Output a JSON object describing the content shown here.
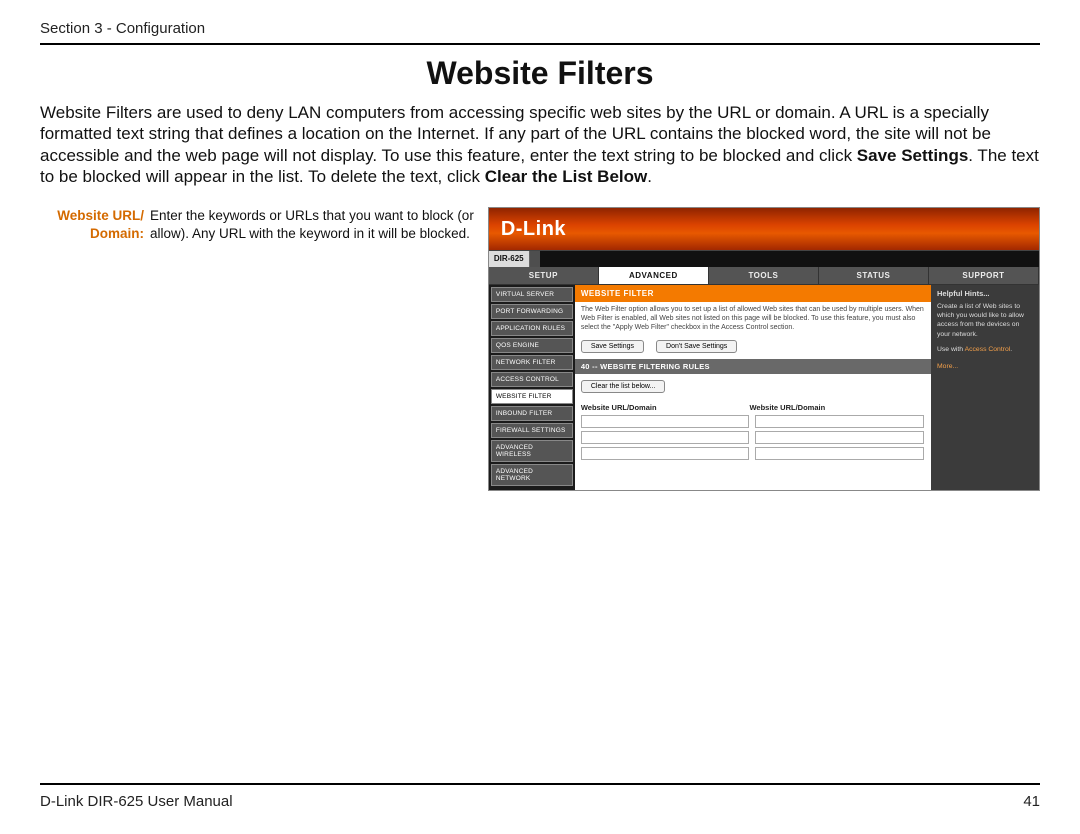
{
  "header": {
    "section": "Section 3 - Configuration"
  },
  "title": "Website Filters",
  "intro_p1": "Website Filters are used to deny LAN computers from accessing specific web sites by the URL or domain. A URL is a specially formatted text string that defines a location on the Internet. If any part of the URL contains the blocked word, the site will not be accessible and the web page will not display. To use this feature, enter the text string to be blocked and click ",
  "intro_b1": "Save Settings",
  "intro_p2": ". The text to be blocked will appear in the list. To delete the text, click ",
  "intro_b2": "Clear the List Below",
  "intro_p3": ".",
  "desc": {
    "label": "Website URL/ Domain:",
    "text": "Enter the keywords or URLs that you want to block (or allow). Any URL with the keyword in it will be blocked."
  },
  "router": {
    "brand": "D-Link",
    "model": "DIR-625",
    "tabs": [
      "SETUP",
      "ADVANCED",
      "TOOLS",
      "STATUS",
      "SUPPORT"
    ],
    "active_tab": 1,
    "side_items": [
      "VIRTUAL SERVER",
      "PORT FORWARDING",
      "APPLICATION RULES",
      "QOS ENGINE",
      "NETWORK FILTER",
      "ACCESS CONTROL",
      "WEBSITE FILTER",
      "INBOUND FILTER",
      "FIREWALL SETTINGS",
      "ADVANCED WIRELESS",
      "ADVANCED NETWORK"
    ],
    "active_side": 6,
    "panel_title": "WEBSITE FILTER",
    "panel_text": "The Web Filter option allows you to set up a list of allowed Web sites that can be used by multiple users. When Web Filter is enabled, all Web sites not listed on this page will be blocked. To use this feature, you must also select the \"Apply Web Filter\" checkbox in the Access Control section.",
    "buttons": {
      "save": "Save Settings",
      "dont": "Don't Save Settings"
    },
    "sub_header": "40 -- WEBSITE FILTERING RULES",
    "clear_btn": "Clear the list below...",
    "col_header": "Website URL/Domain",
    "hints": {
      "title": "Helpful Hints...",
      "text": "Create a list of Web sites to which you would like to allow access from the devices on your network.",
      "usewith": "Use with ",
      "usewith_link": "Access Control",
      "more": "More..."
    }
  },
  "footer": {
    "left": "D-Link DIR-625 User Manual",
    "page": "41"
  }
}
